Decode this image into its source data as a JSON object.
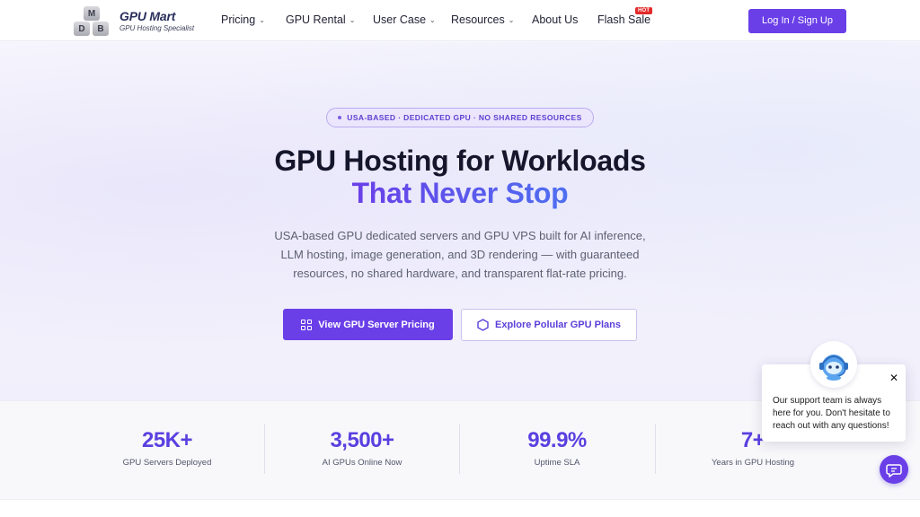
{
  "brand": {
    "logo_letters": [
      "M",
      "D",
      "B"
    ],
    "name": "GPU Mart",
    "tagline": "GPU Hosting Specialist"
  },
  "nav": {
    "items": [
      {
        "label": "Pricing",
        "has_dropdown": true
      },
      {
        "label": "GPU Rental",
        "has_dropdown": true
      },
      {
        "label": "User Case",
        "has_dropdown": true
      },
      {
        "label": "Resources",
        "has_dropdown": true
      },
      {
        "label": "About Us",
        "has_dropdown": false
      },
      {
        "label": "Flash Sale",
        "has_dropdown": false
      }
    ],
    "hot_badge": "HOT",
    "login_label": "Log In / Sign Up"
  },
  "hero": {
    "pill": "USA-BASED · DEDICATED GPU · NO SHARED RESOURCES",
    "title_line1": "GPU Hosting for Workloads",
    "title_line2": "That Never Stop",
    "description": "USA-based GPU dedicated servers and GPU VPS built for AI inference, LLM hosting, image generation, and 3D rendering — with guaranteed resources, no shared hardware, and transparent flat-rate pricing.",
    "primary_button": "View GPU Server Pricing",
    "secondary_button": "Explore Polular GPU Plans"
  },
  "stats": [
    {
      "value": "25K+",
      "label": "GPU Servers Deployed"
    },
    {
      "value": "3,500+",
      "label": "AI GPUs Online Now"
    },
    {
      "value": "99.9%",
      "label": "Uptime SLA"
    },
    {
      "value": "7+",
      "label": "Years in GPU Hosting"
    }
  ],
  "chat": {
    "message": "Our support team is always here for you. Don't hesitate to reach out with any questions!",
    "close_symbol": "✕"
  },
  "colors": {
    "accent": "#6a3fe8",
    "hot": "#e42a2a",
    "stat_value": "#5a40e0"
  }
}
